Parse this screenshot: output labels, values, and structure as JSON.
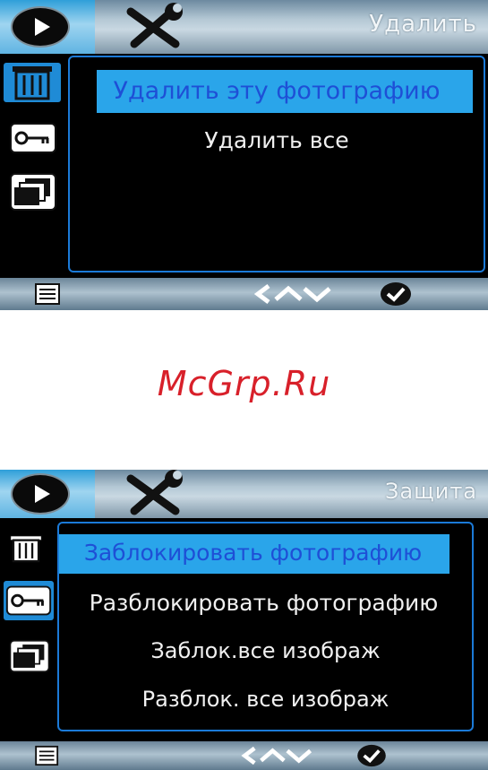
{
  "screen_delete": {
    "title": "Удалить",
    "menu": [
      "Удалить эту фотографию",
      "Удалить все"
    ],
    "selected_index": 0,
    "side_icons": [
      "trash-icon",
      "key-icon",
      "slideshow-icon"
    ],
    "active_side_icon": "trash-icon"
  },
  "watermark": "McGrp.Ru",
  "screen_protect": {
    "title": "Защита",
    "menu": [
      "Заблокировать фотографию",
      "Разблокировать фотографию",
      "Заблок.все изображ",
      "Разблок. все изображ"
    ],
    "selected_index": 0,
    "side_icons": [
      "trash-icon",
      "key-icon",
      "slideshow-icon"
    ],
    "active_side_icon": "key-icon"
  },
  "bottom_bar": {
    "icons": [
      "menu-icon",
      "navigate-arrows-icon",
      "confirm-check-icon"
    ]
  },
  "colors": {
    "highlight": "#2aa5ea",
    "selected_text": "#1e4fd6",
    "panel_border": "#1b7ad8",
    "watermark": "#d8202a"
  }
}
